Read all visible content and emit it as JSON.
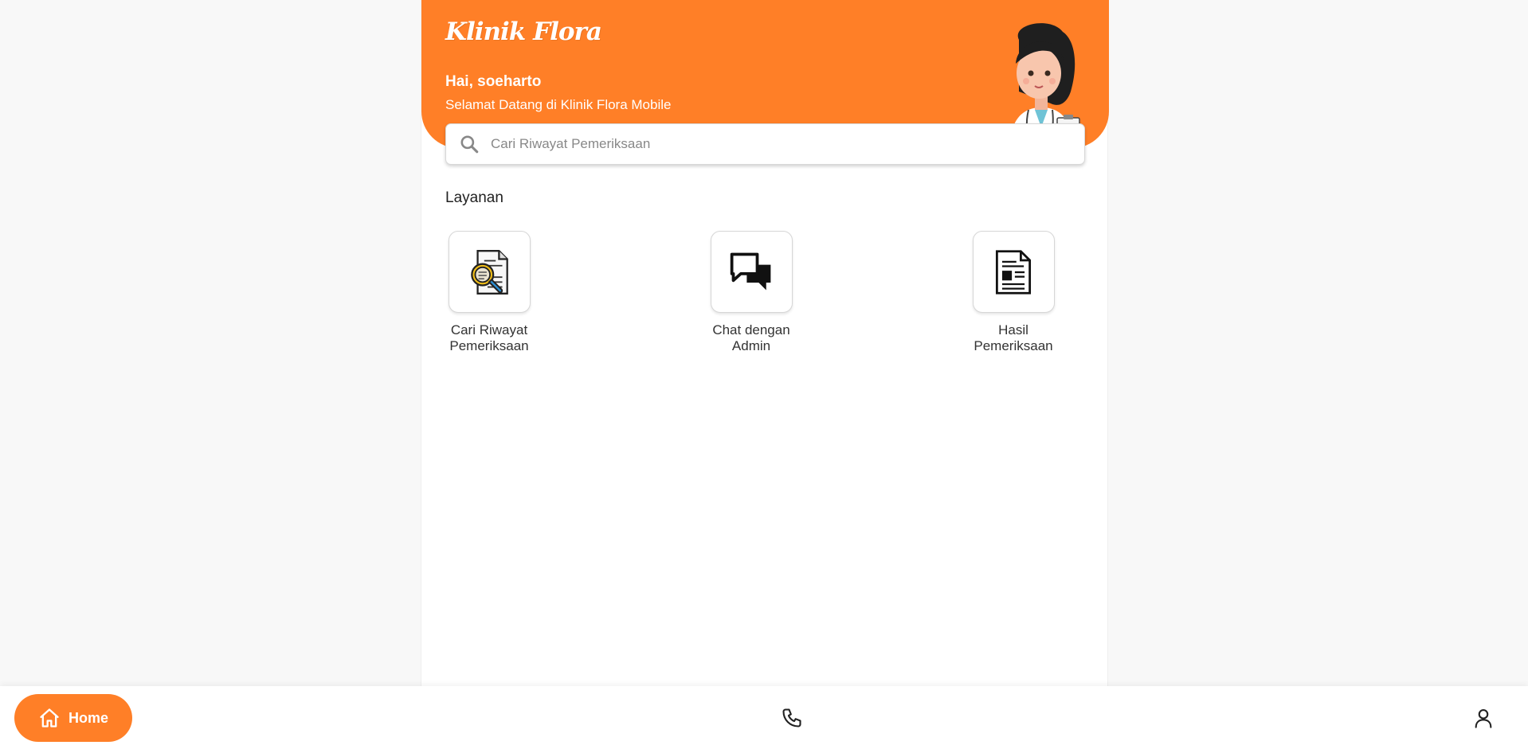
{
  "app": {
    "title": "Klinik Flora",
    "greeting": "Hai, soeharto",
    "welcome": "Selamat Datang di Klinik Flora Mobile",
    "accent_color": "#ff7f27"
  },
  "search": {
    "placeholder": "Cari Riwayat Pemeriksaan",
    "icon": "search-icon"
  },
  "services": {
    "title": "Layanan",
    "items": [
      {
        "label": "Cari Riwayat Pemeriksaan",
        "icon": "document-search-icon"
      },
      {
        "label": "Chat dengan Admin",
        "icon": "chat-bubbles-icon"
      },
      {
        "label": "Hasil Pemeriksaan",
        "icon": "document-report-icon"
      }
    ]
  },
  "bottom_nav": {
    "home_label": "Home",
    "items": [
      {
        "icon": "home-icon",
        "active": true
      },
      {
        "icon": "phone-icon",
        "active": false
      },
      {
        "icon": "user-icon",
        "active": false
      }
    ]
  }
}
